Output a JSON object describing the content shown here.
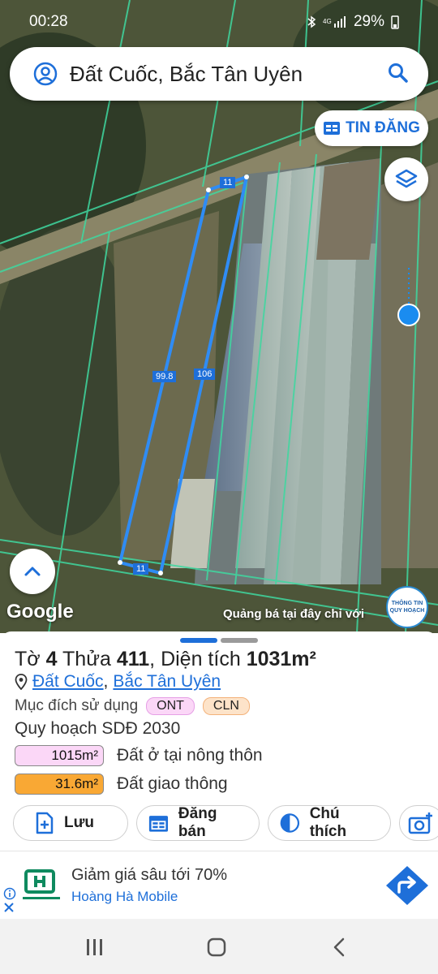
{
  "status": {
    "time": "00:28",
    "battery": "29%"
  },
  "search": {
    "query": "Đất Cuốc, Bắc Tân Uyên"
  },
  "map": {
    "tin_dang_label": "TIN ĐĂNG",
    "google_label": "Google",
    "promo_text": "Quảng bá tại đây chỉ với",
    "qh_logo_line1": "THÔNG TIN",
    "qh_logo_line2": "QUY HOẠCH",
    "dimensions": {
      "top": "11",
      "left": "99.8",
      "right": "106",
      "bottom": "11"
    }
  },
  "parcel": {
    "to_label": "Tờ",
    "to_value": "4",
    "thua_label": "Thửa",
    "thua_value": "411",
    "area_label": "Diện tích",
    "area_value": "1031m²",
    "location_part1": "Đất Cuốc",
    "location_sep": ",",
    "location_part2": "Bắc Tân Uyên",
    "purpose_label": "Mục đích sử dụng",
    "purpose_tags": [
      "ONT",
      "CLN"
    ],
    "plan_title": "Quy hoạch SDĐ 2030",
    "plan_items": [
      {
        "area": "1015m²",
        "label": "Đất ở tại nông thôn",
        "color": "#fbd7f7"
      },
      {
        "area": "31.6m²",
        "label": "Đất giao thông",
        "color": "#f9a834"
      }
    ]
  },
  "actions": {
    "save": "Lưu",
    "post": "Đăng bán",
    "legend": "Chú thích"
  },
  "ad": {
    "title": "Giảm giá sâu tới 70%",
    "sponsor": "Hoàng Hà Mobile"
  },
  "colors": {
    "accent": "#1e6fd9",
    "parcel_outline": "#2f8cf5",
    "ont": "#fbd7f7",
    "cln": "#fde3c9",
    "traffic": "#f9a834"
  }
}
